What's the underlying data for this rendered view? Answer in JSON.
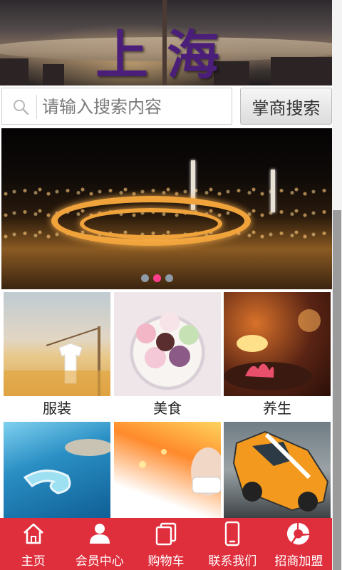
{
  "banner": {
    "title": "上海"
  },
  "search": {
    "placeholder": "请输入搜索内容",
    "button_label": "掌商搜索",
    "icon": "search-icon"
  },
  "slider": {
    "dot_count": 3,
    "active_index": 1
  },
  "categories": [
    {
      "label": "服装"
    },
    {
      "label": "美食"
    },
    {
      "label": "养生"
    }
  ],
  "tabbar": {
    "items": [
      {
        "label": "主页",
        "icon": "home-icon"
      },
      {
        "label": "会员中心",
        "icon": "member-icon"
      },
      {
        "label": "购物车",
        "icon": "cart-icon"
      },
      {
        "label": "联系我们",
        "icon": "phone-icon"
      },
      {
        "label": "招商加盟",
        "icon": "partner-icon"
      }
    ]
  },
  "colors": {
    "tabbar_bg": "#df2f3d",
    "active_dot": "#ff3f8d",
    "banner_title": "#4b1e7a"
  }
}
